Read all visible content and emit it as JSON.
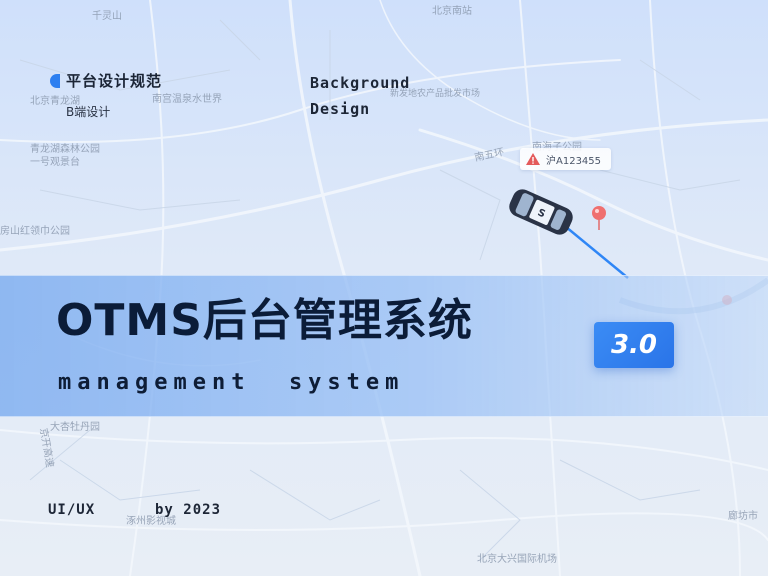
{
  "brand": {
    "title": "平台设计规范",
    "subtitle": "B端设计"
  },
  "background_design": {
    "line1": "Background",
    "line2": "Design"
  },
  "vehicle": {
    "plate": "沪A123455"
  },
  "title": {
    "main": "OTMS后台管理系统",
    "sub": "management  system",
    "version": "3.0"
  },
  "footer": {
    "left": "UI/UX",
    "right": "by 2023"
  },
  "colors": {
    "accent": "#2d7ff0",
    "title": "#0b1c38",
    "banner": "#8fb8f2"
  },
  "map_labels": [
    "千灵山",
    "北京南站",
    "北京青龙湖",
    "南宫温泉水世界",
    "新发地农产品批发市场",
    "南五环",
    "南海子公园",
    "青龙湖森林公园一号观景台",
    "房山红领巾公园",
    "大杏牡丹园",
    "京开高速",
    "涿州影视城",
    "北京大兴国际机场",
    "廊坊市"
  ]
}
